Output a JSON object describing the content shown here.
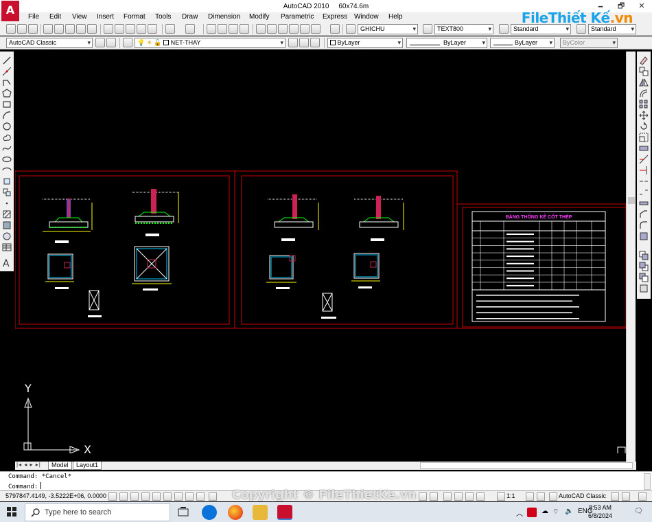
{
  "window": {
    "app_title": "AutoCAD 2010",
    "doc_title": "60x74.6m",
    "minimize": "🗕",
    "restore": "🗗",
    "close": "✕"
  },
  "watermark": {
    "logo_main": "File",
    "logo_mid": "Thiết Kế",
    "logo_end": ".vn",
    "copyright": "Copyright © FileThietKe.vn"
  },
  "menu": [
    "File",
    "Edit",
    "View",
    "Insert",
    "Format",
    "Tools",
    "Draw",
    "Dimension",
    "Modify",
    "Parametric",
    "Express",
    "Window",
    "Help"
  ],
  "toolbar1": {
    "text_style": "GHICHU",
    "dim_style": "TEXT800",
    "table_style": "Standard",
    "multileader_style": "Standard"
  },
  "toolbar2": {
    "workspace": "AutoCAD Classic",
    "layer": "NET-THAY",
    "color": "ByLayer",
    "linetype": "ByLayer",
    "lineweight": "ByLayer",
    "plotstyle": "ByColor"
  },
  "drawing": {
    "sheet3_title": "BẢNG THỐNG KÊ CỐT THÉP",
    "ucs_y": "Y",
    "ucs_x": "X",
    "colors": {
      "frame": "#cc0000",
      "cyan": "#00c8ff",
      "green": "#00ff00",
      "white": "#ffffff",
      "yellow": "#ffff00",
      "magenta": "#ff40ff",
      "blue": "#3060ff"
    }
  },
  "tabs": {
    "nav": "|◂ ◂ ▸ ▸|",
    "model": "Model",
    "layout1": "Layout1"
  },
  "command": {
    "line1": "Command: *Cancel*",
    "line2": "Command:"
  },
  "status": {
    "coords": "5797847.4149, -3.5222E+06, 0.0000",
    "scale": "1:1",
    "workspace": "AutoCAD Classic"
  },
  "taskbar": {
    "search_placeholder": "Type here to search",
    "language": "ENG",
    "time": "8:53 AM",
    "date": "6/8/2024"
  }
}
